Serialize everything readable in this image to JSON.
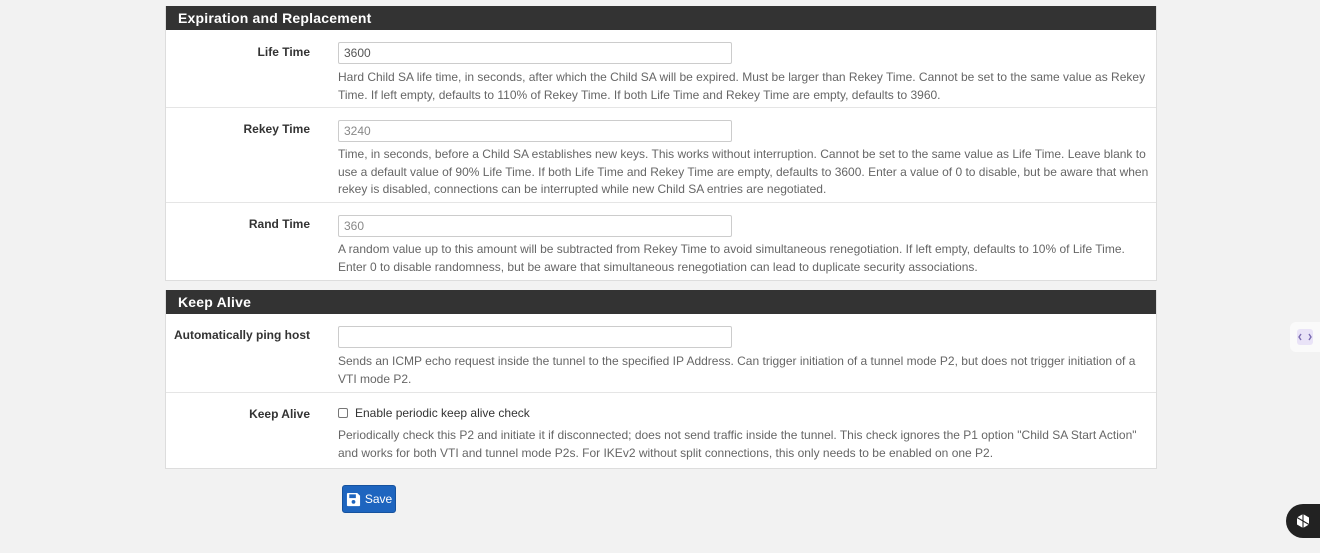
{
  "expiration": {
    "heading": "Expiration and Replacement",
    "life_time": {
      "label": "Life Time",
      "value": "3600",
      "placeholder": "",
      "help": "Hard Child SA life time, in seconds, after which the Child SA will be expired. Must be larger than Rekey Time. Cannot be set to the same value as Rekey Time. If left empty, defaults to 110% of Rekey Time. If both Life Time and Rekey Time are empty, defaults to 3960."
    },
    "rekey_time": {
      "label": "Rekey Time",
      "value": "",
      "placeholder": "3240",
      "help": "Time, in seconds, before a Child SA establishes new keys. This works without interruption. Cannot be set to the same value as Life Time. Leave blank to use a default value of 90% Life Time. If both Life Time and Rekey Time are empty, defaults to 3600. Enter a value of 0 to disable, but be aware that when rekey is disabled, connections can be interrupted while new Child SA entries are negotiated."
    },
    "rand_time": {
      "label": "Rand Time",
      "value": "",
      "placeholder": "360",
      "help": "A random value up to this amount will be subtracted from Rekey Time to avoid simultaneous renegotiation. If left empty, defaults to 10% of Life Time. Enter 0 to disable randomness, but be aware that simultaneous renegotiation can lead to duplicate security associations."
    }
  },
  "keepalive": {
    "heading": "Keep Alive",
    "ping_host": {
      "label": "Automatically ping host",
      "value": "",
      "placeholder": "",
      "help": "Sends an ICMP echo request inside the tunnel to the specified IP Address. Can trigger initiation of a tunnel mode P2, but does not trigger initiation of a VTI mode P2."
    },
    "keep_alive": {
      "label": "Keep Alive",
      "checkbox_label": "Enable periodic keep alive check",
      "checked": false,
      "help": "Periodically check this P2 and initiate it if disconnected; does not send traffic inside the tunnel. This check ignores the P1 option \"Child SA Start Action\" and works for both VTI and tunnel mode P2s. For IKEv2 without split connections, this only needs to be enabled on one P2."
    }
  },
  "save_label": "Save",
  "icons": {
    "save": "floppy-disk-icon",
    "side": "code-icon",
    "corner": "cube-icon"
  },
  "colors": {
    "heading_bg": "#333333",
    "button_bg": "#1e65bf"
  }
}
